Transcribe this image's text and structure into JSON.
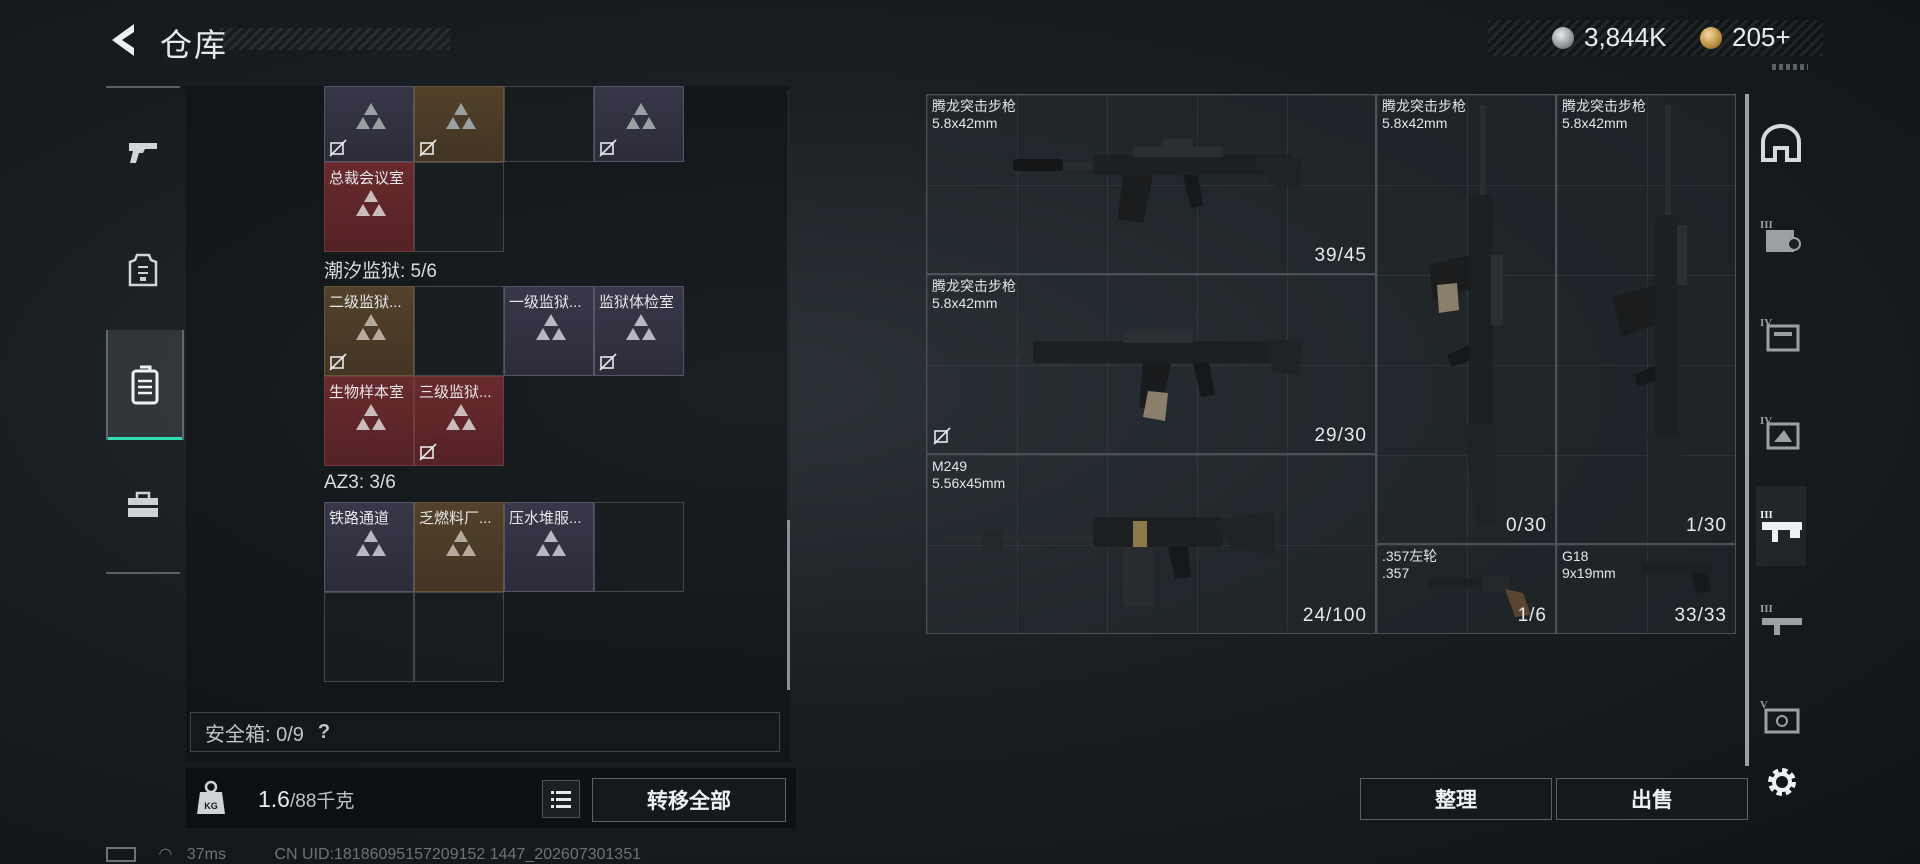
{
  "header": {
    "title": "仓库",
    "currency": {
      "silver": "3,844K",
      "gold": "205+"
    }
  },
  "left_sidebar": {
    "items": [
      {
        "icon": "pistol-icon"
      },
      {
        "icon": "armor-icon"
      },
      {
        "icon": "backpack-icon",
        "active": true
      },
      {
        "icon": "toolbox-icon"
      }
    ]
  },
  "backpack": {
    "top_row": [
      {
        "name": "",
        "color": "purple",
        "locked": true
      },
      {
        "name": "",
        "color": "gold",
        "locked": true
      },
      {
        "name": "",
        "color": "empty",
        "locked": false
      },
      {
        "name": "",
        "color": "purple",
        "locked": true
      }
    ],
    "extra_cell": {
      "name": "总裁会议室",
      "color": "red"
    },
    "groups": [
      {
        "label": "潮汐监狱: 5/6",
        "cells": [
          {
            "name": "二级监狱...",
            "color": "gold",
            "locked": true
          },
          {
            "name": "",
            "color": "empty"
          },
          {
            "name": "一级监狱...",
            "color": "purple"
          },
          {
            "name": "监狱体检室",
            "color": "purple",
            "locked": true
          },
          {
            "name": "生物样本室",
            "color": "red"
          },
          {
            "name": "三级监狱...",
            "color": "red",
            "locked": true
          }
        ]
      },
      {
        "label": "AZ3: 3/6",
        "cells": [
          {
            "name": "铁路通道",
            "color": "purple"
          },
          {
            "name": "乏燃料厂...",
            "color": "gold"
          },
          {
            "name": "压水堆服...",
            "color": "purple"
          },
          {
            "name": "",
            "color": "empty"
          },
          {
            "name": "",
            "color": "empty"
          },
          {
            "name": "",
            "color": "empty"
          }
        ]
      }
    ],
    "safe_box": "安全箱: 0/9",
    "safe_help": "?"
  },
  "weight": {
    "current": "1.6",
    "max": "/88千克"
  },
  "buttons": {
    "transfer_all": "转移全部",
    "sort": "整理",
    "sell": "出售"
  },
  "warehouse": {
    "weapons": [
      {
        "name": "腾龙突击步枪",
        "caliber": "5.8x42mm",
        "ammo": "39/45",
        "locked": false
      },
      {
        "name": "腾龙突击步枪",
        "caliber": "5.8x42mm",
        "ammo": "29/30",
        "locked": true
      },
      {
        "name": "M249",
        "caliber": "5.56x45mm",
        "ammo": "24/100",
        "locked": false
      },
      {
        "name": "腾龙突击步枪",
        "caliber": "5.8x42mm",
        "ammo": "0/30",
        "locked": false
      },
      {
        "name": "腾龙突击步枪",
        "caliber": "5.8x42mm",
        "ammo": "1/30",
        "locked": false
      },
      {
        "name": ".357左轮",
        "caliber": ".357",
        "ammo": "1/6",
        "locked": false
      },
      {
        "name": "G18",
        "caliber": "9x19mm",
        "ammo": "33/33",
        "locked": false
      }
    ]
  },
  "right_sidebar": {
    "items": [
      {
        "icon": "helmet-icon",
        "badge": ""
      },
      {
        "icon": "tier-armor-icon",
        "badge": "III"
      },
      {
        "icon": "tier-folder-icon",
        "badge": "IV"
      },
      {
        "icon": "tier-map-icon",
        "badge": "IV"
      },
      {
        "icon": "tier-weapon-icon",
        "badge": "III",
        "active": true
      },
      {
        "icon": "tier-rifle-icon",
        "badge": "III"
      },
      {
        "icon": "tier-case-icon",
        "badge": "V"
      }
    ]
  },
  "status": {
    "ping": "37ms",
    "uid": "CN UID:18186095157209152 1447_202607301351"
  }
}
